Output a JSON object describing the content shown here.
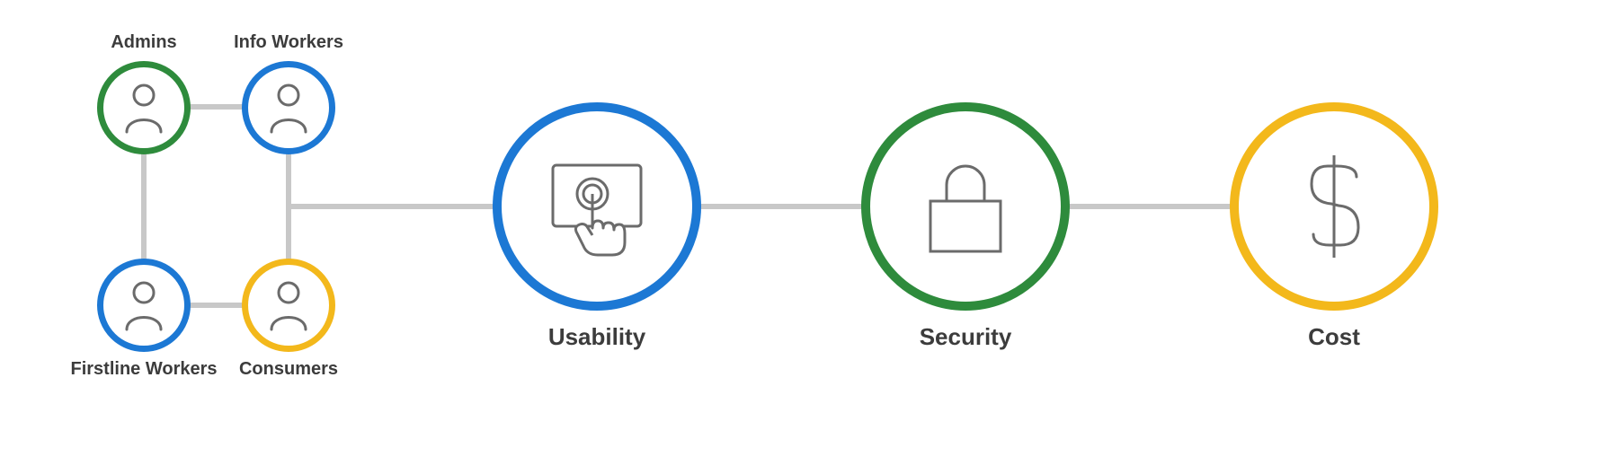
{
  "colors": {
    "green": "#2e8b3c",
    "blue": "#1c78d4",
    "yellow": "#f3b81b",
    "icon": "#6b6b6b",
    "connector": "#c8c8c8",
    "text": "#3c3c3c"
  },
  "personas": {
    "admins": {
      "label": "Admins",
      "color": "green"
    },
    "info": {
      "label": "Info Workers",
      "color": "blue"
    },
    "firstline": {
      "label": "Firstline Workers",
      "color": "blue"
    },
    "consumers": {
      "label": "Consumers",
      "color": "yellow"
    }
  },
  "pillars": {
    "usability": {
      "label": "Usability",
      "color": "blue"
    },
    "security": {
      "label": "Security",
      "color": "green"
    },
    "cost": {
      "label": "Cost",
      "color": "yellow"
    }
  }
}
